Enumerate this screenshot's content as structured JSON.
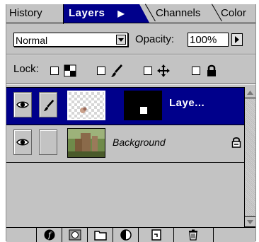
{
  "tabs": {
    "history": "History",
    "layers": "Layers",
    "channels": "Channels",
    "color": "Color"
  },
  "blend": {
    "mode": "Normal",
    "opacity_label": "Opacity:",
    "opacity_value": "100%"
  },
  "lock": {
    "label": "Lock:"
  },
  "layers": [
    {
      "name": "Laye...",
      "selected": true,
      "visible": true
    },
    {
      "name": "Background",
      "selected": false,
      "visible": true,
      "locked": true
    }
  ],
  "colors": {
    "panel_bg": "#c3c3c3",
    "selected_tab": "#00008b",
    "selected_row": "#00008b"
  }
}
